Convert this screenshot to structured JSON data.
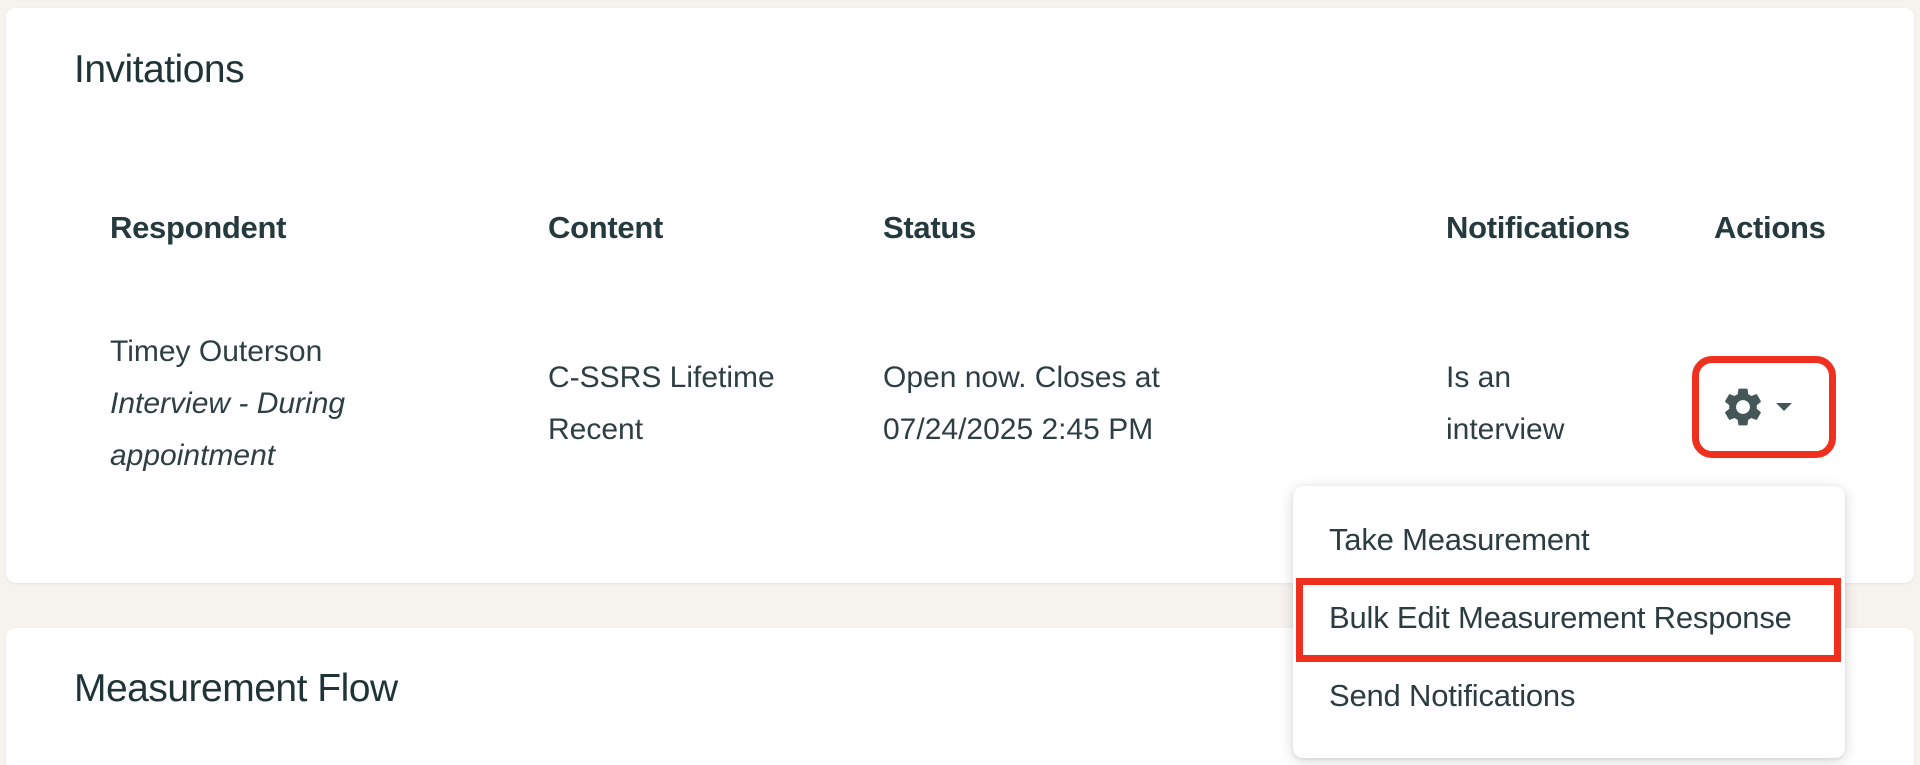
{
  "invitations": {
    "title": "Invitations",
    "columns": {
      "respondent": "Respondent",
      "content": "Content",
      "status": "Status",
      "notifications": "Notifications",
      "actions": "Actions"
    },
    "row": {
      "respondent_name": "Timey Outerson",
      "respondent_mode_line1": "Interview - During",
      "respondent_mode_line2": "appointment",
      "content": "C-SSRS Lifetime Recent",
      "status": "Open now. Closes at 07/24/2025 2:45 PM",
      "notifications": "Is an interview",
      "actions_icon": "gear-icon"
    }
  },
  "actions_menu": {
    "items": [
      {
        "label": "Take Measurement"
      },
      {
        "label": "Bulk Edit Measurement Response"
      },
      {
        "label": "Send Notifications"
      }
    ]
  },
  "measurement_flow": {
    "title": "Measurement Flow"
  },
  "colors": {
    "highlight": "#f0301f",
    "text_dark": "#21363a",
    "background": "#f6f3ef"
  }
}
